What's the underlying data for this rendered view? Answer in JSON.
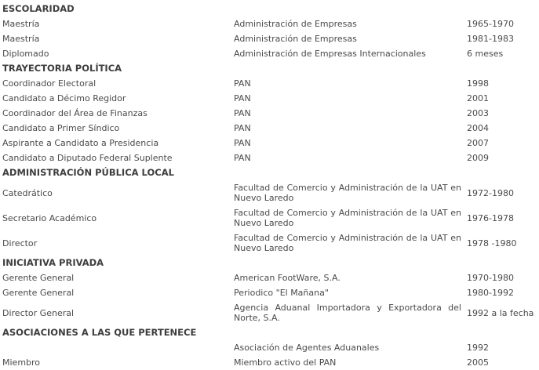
{
  "sections": [
    {
      "title": "ESCOLARIDAD",
      "rows": [
        {
          "role": "Maestría",
          "org": "Administración de Empresas",
          "period": "1965-1970"
        },
        {
          "role": "Maestría",
          "org": "Administración de Empresas",
          "period": "1981-1983"
        },
        {
          "role": "Diplomado",
          "org": "Administración de Empresas Internacionales",
          "period": "6 meses"
        }
      ]
    },
    {
      "title": "TRAYECTORIA POLÍTICA",
      "rows": [
        {
          "role": "Coordinador Electoral",
          "org": "PAN",
          "period": "1998"
        },
        {
          "role": "Candidato a Décimo Regidor",
          "org": "PAN",
          "period": "2001"
        },
        {
          "role": "Coordinador del Área de Finanzas",
          "org": "PAN",
          "period": "2003"
        },
        {
          "role": "Candidato a Primer Síndico",
          "org": "PAN",
          "period": "2004"
        },
        {
          "role": "Aspirante a Candidato a Presidencia",
          "org": "PAN",
          "period": "2007"
        },
        {
          "role": "Candidato a Diputado Federal Suplente",
          "org": "PAN",
          "period": "2009"
        }
      ]
    },
    {
      "title": "ADMINISTRACIÓN PÚBLICA LOCAL",
      "rows": [
        {
          "role": "Catedrático",
          "org": "Facultad de Comercio y Administración de la UAT en Nuevo Laredo",
          "period": "1972-1980"
        },
        {
          "role": "Secretario Académico",
          "org": "Facultad de Comercio y Administración de la UAT en Nuevo Laredo",
          "period": "1976-1978"
        },
        {
          "role": "Director",
          "org": "Facultad de Comercio y Administración de la UAT en Nuevo Laredo",
          "period": "1978 -1980"
        }
      ]
    },
    {
      "title": "INICIATIVA PRIVADA",
      "rows": [
        {
          "role": "Gerente General",
          "org": "American FootWare, S.A.",
          "period": "1970-1980"
        },
        {
          "role": "Gerente General",
          "org": "Periodico \"El Mañana\"",
          "period": "1980-1992"
        },
        {
          "role": "Director General",
          "org": "Agencia Aduanal Importadora y Exportadora del Norte, S.A.",
          "period": "1992 a la fecha"
        }
      ]
    },
    {
      "title": "ASOCIACIONES A LAS QUE PERTENECE",
      "rows": [
        {
          "role": "",
          "org": "Asociación de Agentes Aduanales",
          "period": "1992"
        },
        {
          "role": "Miembro",
          "org": "Miembro activo del PAN",
          "period": "2005"
        }
      ]
    }
  ]
}
